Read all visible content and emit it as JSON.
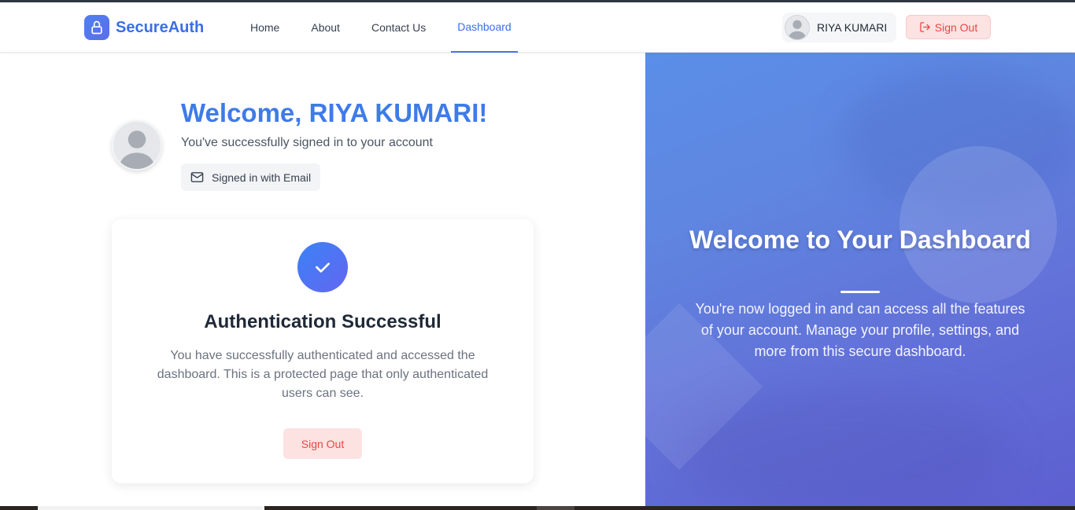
{
  "brand": {
    "name": "SecureAuth",
    "icon": "lock-icon",
    "accent": "#3b6ee8"
  },
  "nav": {
    "links": [
      {
        "label": "Home",
        "active": false
      },
      {
        "label": "About",
        "active": false
      },
      {
        "label": "Contact Us",
        "active": false
      },
      {
        "label": "Dashboard",
        "active": true
      }
    ],
    "user_name": "RIYA KUMARI",
    "signout_label": "Sign Out"
  },
  "profile": {
    "welcome": "Welcome, RIYA KUMARI!",
    "subtitle": "You've successfully signed in to your account",
    "signin_method": "Signed in with Email"
  },
  "auth_card": {
    "title": "Authentication Successful",
    "description": "You have successfully authenticated and accessed the dashboard. This is a protected page that only authenticated users can see.",
    "signout_label": "Sign Out"
  },
  "hero": {
    "title": "Welcome to Your Dashboard",
    "description": "You're now logged in and can access all the features of your account. Manage your profile, settings, and more from this secure dashboard."
  },
  "colors": {
    "primary": "#3f7be8",
    "danger": "#ef4444",
    "danger_bg": "#fde2e2",
    "hero_gradient_start": "#5a8ee8",
    "hero_gradient_end": "#5d5fd0"
  }
}
